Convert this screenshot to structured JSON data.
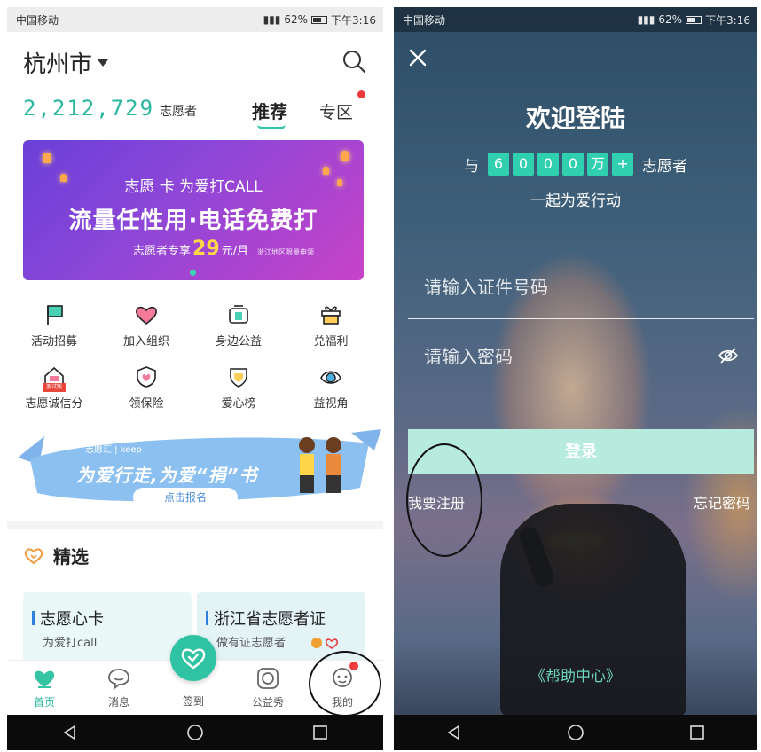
{
  "left_screen": {
    "status_bar": {
      "carrier": "中国移动",
      "battery": "62%",
      "time": "下午3:16"
    },
    "header": {
      "city": "杭州市",
      "volunteer_count": "2,212,729",
      "volunteer_label": "志愿者",
      "tab_recommend": "推荐",
      "tab_zone": "专区"
    },
    "banner": {
      "subtitle": "志愿  卡 为爱打CALL",
      "headline": "流量任性用·电话免费打",
      "price_prefix": "志愿者专享",
      "price_value": "29",
      "price_unit": "元/月",
      "region_note": "浙江地区限量申领"
    },
    "grid": [
      {
        "label": "活动招募",
        "icon": "flag-icon"
      },
      {
        "label": "加入组织",
        "icon": "heart-icon"
      },
      {
        "label": "身边公益",
        "icon": "nearby-icon"
      },
      {
        "label": "兑福利",
        "icon": "gift-icon"
      },
      {
        "label": "志愿诚信分",
        "icon": "credit-icon",
        "badge": "测试版"
      },
      {
        "label": "领保险",
        "icon": "shield-heart-icon"
      },
      {
        "label": "爱心榜",
        "icon": "trophy-shield-icon"
      },
      {
        "label": "益视角",
        "icon": "eye-icon"
      }
    ],
    "keep_banner": {
      "logo_text": "志愿汇 | keep",
      "headline": "为爱行走,为爱“捐”书",
      "button": "点击报名"
    },
    "featured": {
      "title": "精选"
    },
    "cards": [
      {
        "title": "志愿心卡",
        "subtitle": "为爱打call"
      },
      {
        "title": "浙江省志愿者证",
        "subtitle": "做有证志愿者"
      }
    ],
    "tabs": [
      {
        "label": "首页",
        "icon": "home-heart-icon"
      },
      {
        "label": "消息",
        "icon": "message-icon"
      },
      {
        "label": "签到",
        "icon": "checkin-icon"
      },
      {
        "label": "公益秀",
        "icon": "camera-icon"
      },
      {
        "label": "我的",
        "icon": "profile-icon"
      }
    ]
  },
  "right_screen": {
    "status_bar": {
      "carrier": "中国移动",
      "battery": "62%",
      "time": "下午3:16"
    },
    "title": "欢迎登陆",
    "stat_prefix": "与",
    "stat_digits": [
      "6",
      "0",
      "0",
      "0",
      "万",
      "+"
    ],
    "stat_suffix": "志愿者",
    "slogan": "一起为爱行动",
    "id_placeholder": "请输入证件号码",
    "password_placeholder": "请输入密码",
    "login_button": "登录",
    "register_link": "我要注册",
    "forgot_link": "忘记密码",
    "help_link": "《帮助中心》"
  },
  "colors": {
    "accent": "#2fc3a8",
    "login_button": "#b6ebdd",
    "notification": "#ef3b3b",
    "help_link": "#6fd6b9"
  }
}
